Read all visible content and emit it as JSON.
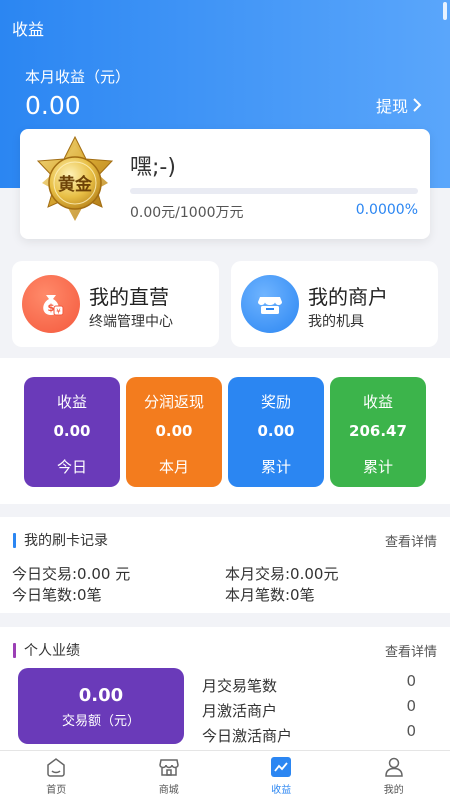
{
  "header": {
    "title": "收益"
  },
  "summary": {
    "month_label": "本月收益（元）",
    "month_value": "0.00",
    "withdraw_label": "提现"
  },
  "level": {
    "badge_text": "黄金",
    "greeting": "嘿;-)",
    "progress_text": "0.00元/1000万元",
    "progress_percent": "0.0000%",
    "progress_fraction": 0.0
  },
  "entries": [
    {
      "title": "我的直营",
      "subtitle": "终端管理中心",
      "icon": "money-bag-icon",
      "color": "#f4593d"
    },
    {
      "title": "我的商户",
      "subtitle": "我的机具",
      "icon": "store-icon",
      "color": "#2b86f2"
    }
  ],
  "stats": [
    {
      "label": "收益",
      "value": "0.00",
      "period": "今日",
      "color": "#6a3ab9"
    },
    {
      "label": "分润返现",
      "value": "0.00",
      "period": "本月",
      "color": "#f37c1e"
    },
    {
      "label": "奖励",
      "value": "0.00",
      "period": "累计",
      "color": "#2b86f2"
    },
    {
      "label": "收益",
      "value": "206.47",
      "period": "累计",
      "color": "#3cb44b"
    }
  ],
  "swipe_records": {
    "title": "我的刷卡记录",
    "more": "查看详情",
    "today_trade": "今日交易:0.00 元",
    "month_trade": "本月交易:0.00元",
    "today_count": "今日笔数:0笔",
    "month_count": "本月笔数:0笔",
    "accent": "#2b86f2"
  },
  "performance": {
    "title": "个人业绩",
    "more": "查看详情",
    "amount_value": "0.00",
    "amount_label": "交易额（元）",
    "rows": [
      {
        "label": "月交易笔数",
        "value": "0"
      },
      {
        "label": "月激活商户",
        "value": "0"
      },
      {
        "label": "今日激活商户",
        "value": "0"
      }
    ],
    "accent": "#9b3fb5"
  },
  "tabbar": [
    {
      "label": "首页",
      "icon": "home-icon",
      "active": false
    },
    {
      "label": "商城",
      "icon": "shop-icon",
      "active": false
    },
    {
      "label": "收益",
      "icon": "earnings-chart-icon",
      "active": true
    },
    {
      "label": "我的",
      "icon": "profile-icon",
      "active": false
    }
  ]
}
